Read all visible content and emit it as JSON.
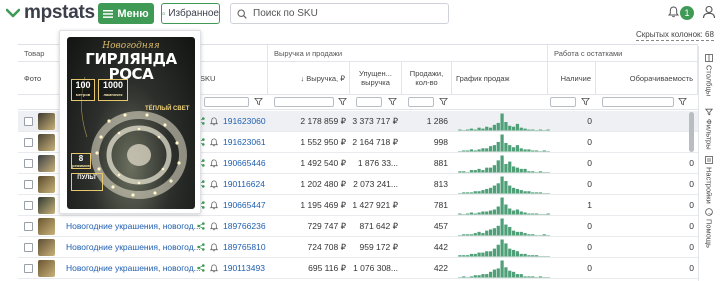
{
  "app": {
    "logo_text": "mpstats",
    "menu_label": "Меню",
    "favorites_label": "Избранное",
    "search_placeholder": "Поиск по SKU",
    "notifications_count": "1",
    "hidden_columns_label": "Скрытых колонок: 68"
  },
  "table": {
    "group_headers": {
      "product": "Товар",
      "sales": "Выручка и продажи",
      "stock": "Работа с остатками"
    },
    "columns": {
      "photo": "Фото",
      "sku": "SKU",
      "revenue": "↓ Выручка, ₽",
      "lost_revenue": "Упущен... выручка",
      "sales_qty": "Продажи, кол-во",
      "sales_chart": "График продаж",
      "availability": "Наличие",
      "turnover": "Оборачиваемость"
    },
    "rows": [
      {
        "name": "",
        "sku": "191623060",
        "revenue": "2 178 859 ₽",
        "lost": "3 373 717 ₽",
        "qty": "1 286",
        "avail": "0",
        "turnover": "0",
        "spark": [
          1,
          0,
          1,
          2,
          1,
          3,
          2,
          4,
          3,
          6,
          8,
          18,
          9,
          5,
          4,
          7,
          3,
          2,
          1,
          1,
          0,
          1,
          0,
          1
        ]
      },
      {
        "name": "",
        "sku": "191623061",
        "revenue": "1 552 950 ₽",
        "lost": "2 164 718 ₽",
        "qty": "998",
        "avail": "0",
        "turnover": "0",
        "spark": [
          0,
          1,
          1,
          2,
          1,
          2,
          3,
          3,
          5,
          6,
          9,
          16,
          8,
          6,
          4,
          6,
          3,
          2,
          2,
          1,
          1,
          0,
          1,
          0
        ]
      },
      {
        "name": "",
        "sku": "190665446",
        "revenue": "1 492 540 ₽",
        "lost": "1 876 33...",
        "qty": "881",
        "avail": "0",
        "turnover": "0",
        "spark": [
          1,
          1,
          0,
          2,
          2,
          3,
          2,
          4,
          4,
          6,
          10,
          14,
          7,
          9,
          5,
          4,
          3,
          3,
          1,
          1,
          0,
          1,
          0,
          0
        ]
      },
      {
        "name": "",
        "sku": "190116624",
        "revenue": "1 202 480 ₽",
        "lost": "2 073 241...",
        "qty": "813",
        "avail": "0",
        "turnover": "0",
        "spark": [
          0,
          1,
          1,
          1,
          2,
          2,
          3,
          4,
          5,
          7,
          9,
          15,
          11,
          7,
          5,
          4,
          3,
          2,
          2,
          1,
          1,
          1,
          0,
          0
        ]
      },
      {
        "name": "",
        "sku": "190665447",
        "revenue": "1 195 469 ₽",
        "lost": "1 427 921 ₽",
        "qty": "781",
        "avail": "1",
        "turnover": "0",
        "spark": [
          1,
          0,
          1,
          2,
          1,
          2,
          3,
          3,
          4,
          5,
          8,
          17,
          10,
          6,
          4,
          5,
          3,
          2,
          1,
          1,
          1,
          0,
          0,
          1
        ]
      },
      {
        "name": "Новогодние украшения, новогод...",
        "sku": "189766236",
        "revenue": "729 747 ₽",
        "lost": "871 642 ₽",
        "qty": "457",
        "avail": "0",
        "turnover": "0",
        "spark": [
          0,
          1,
          1,
          1,
          2,
          3,
          2,
          4,
          5,
          6,
          8,
          14,
          9,
          7,
          4,
          3,
          3,
          2,
          1,
          1,
          0,
          0,
          1,
          0
        ]
      },
      {
        "name": "Новогодние украшения, новогод...",
        "sku": "189765810",
        "revenue": "724 708 ₽",
        "lost": "959 172 ₽",
        "qty": "442",
        "avail": "0",
        "turnover": "0",
        "spark": [
          1,
          1,
          1,
          2,
          2,
          3,
          3,
          4,
          4,
          6,
          9,
          13,
          10,
          6,
          5,
          4,
          2,
          2,
          1,
          1,
          1,
          0,
          0,
          0
        ]
      },
      {
        "name": "Новогодние украшения, новогод...",
        "sku": "190113493",
        "revenue": "695 116 ₽",
        "lost": "1 076 308...",
        "qty": "422",
        "avail": "0",
        "turnover": "0",
        "spark": [
          0,
          1,
          0,
          1,
          2,
          2,
          3,
          3,
          5,
          7,
          8,
          15,
          9,
          6,
          5,
          3,
          3,
          1,
          1,
          1,
          0,
          1,
          0,
          0
        ]
      }
    ]
  },
  "sidebar": {
    "tabs": [
      "Столбцы",
      "Фильтры",
      "Настройки",
      "Помощь"
    ]
  },
  "popup": {
    "subtitle": "Новогодняя",
    "title": "ГИРЛЯНДА РОСА",
    "meters": "100",
    "meters_unit": "метров",
    "bulbs": "1000",
    "bulbs_unit": "лампочек",
    "color": "ТЁПЛЫЙ СВЕТ",
    "modes": "8",
    "modes_unit": "режимов",
    "remote": "ПУЛЬТ"
  },
  "colors": {
    "brand_green": "#3f9a56",
    "link_blue": "#1f5fb0",
    "spark_green": "#4f9f78"
  }
}
